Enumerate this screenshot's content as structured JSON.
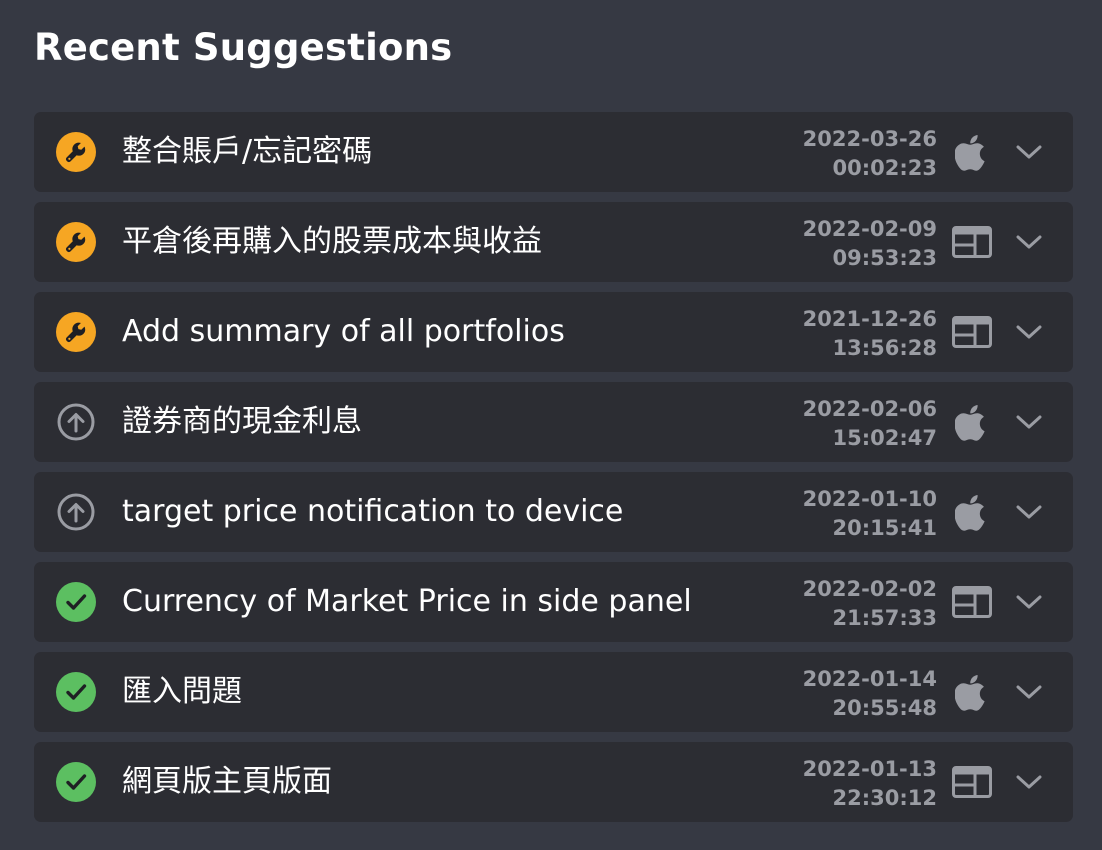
{
  "title": "Recent Suggestions",
  "colors": {
    "background": "#363943",
    "card": "#2c2d33",
    "in_progress": "#f6a623",
    "done": "#5cbf61",
    "muted": "#9a9ca3"
  },
  "suggestions": [
    {
      "status": "in-progress",
      "status_icon": "wrench-icon",
      "label": "整合賬戶/忘記密碼",
      "date": "2022-03-26",
      "time": "00:02:23",
      "platform": "apple-icon"
    },
    {
      "status": "in-progress",
      "status_icon": "wrench-icon",
      "label": "平倉後再購入的股票成本與收益",
      "date": "2022-02-09",
      "time": "09:53:23",
      "platform": "browser-window-icon"
    },
    {
      "status": "in-progress",
      "status_icon": "wrench-icon",
      "label": "Add summary of all portfolios",
      "date": "2021-12-26",
      "time": "13:56:28",
      "platform": "browser-window-icon"
    },
    {
      "status": "planned",
      "status_icon": "arrow-up-circle-icon",
      "label": "證券商的現金利息",
      "date": "2022-02-06",
      "time": "15:02:47",
      "platform": "apple-icon"
    },
    {
      "status": "planned",
      "status_icon": "arrow-up-circle-icon",
      "label": "target price notification to device",
      "date": "2022-01-10",
      "time": "20:15:41",
      "platform": "apple-icon"
    },
    {
      "status": "done",
      "status_icon": "checkmark-icon",
      "label": "Currency of Market Price in side panel",
      "date": "2022-02-02",
      "time": "21:57:33",
      "platform": "browser-window-icon"
    },
    {
      "status": "done",
      "status_icon": "checkmark-icon",
      "label": "匯入問題",
      "date": "2022-01-14",
      "time": "20:55:48",
      "platform": "apple-icon"
    },
    {
      "status": "done",
      "status_icon": "checkmark-icon",
      "label": "網頁版主頁版面",
      "date": "2022-01-13",
      "time": "22:30:12",
      "platform": "browser-window-icon"
    }
  ]
}
